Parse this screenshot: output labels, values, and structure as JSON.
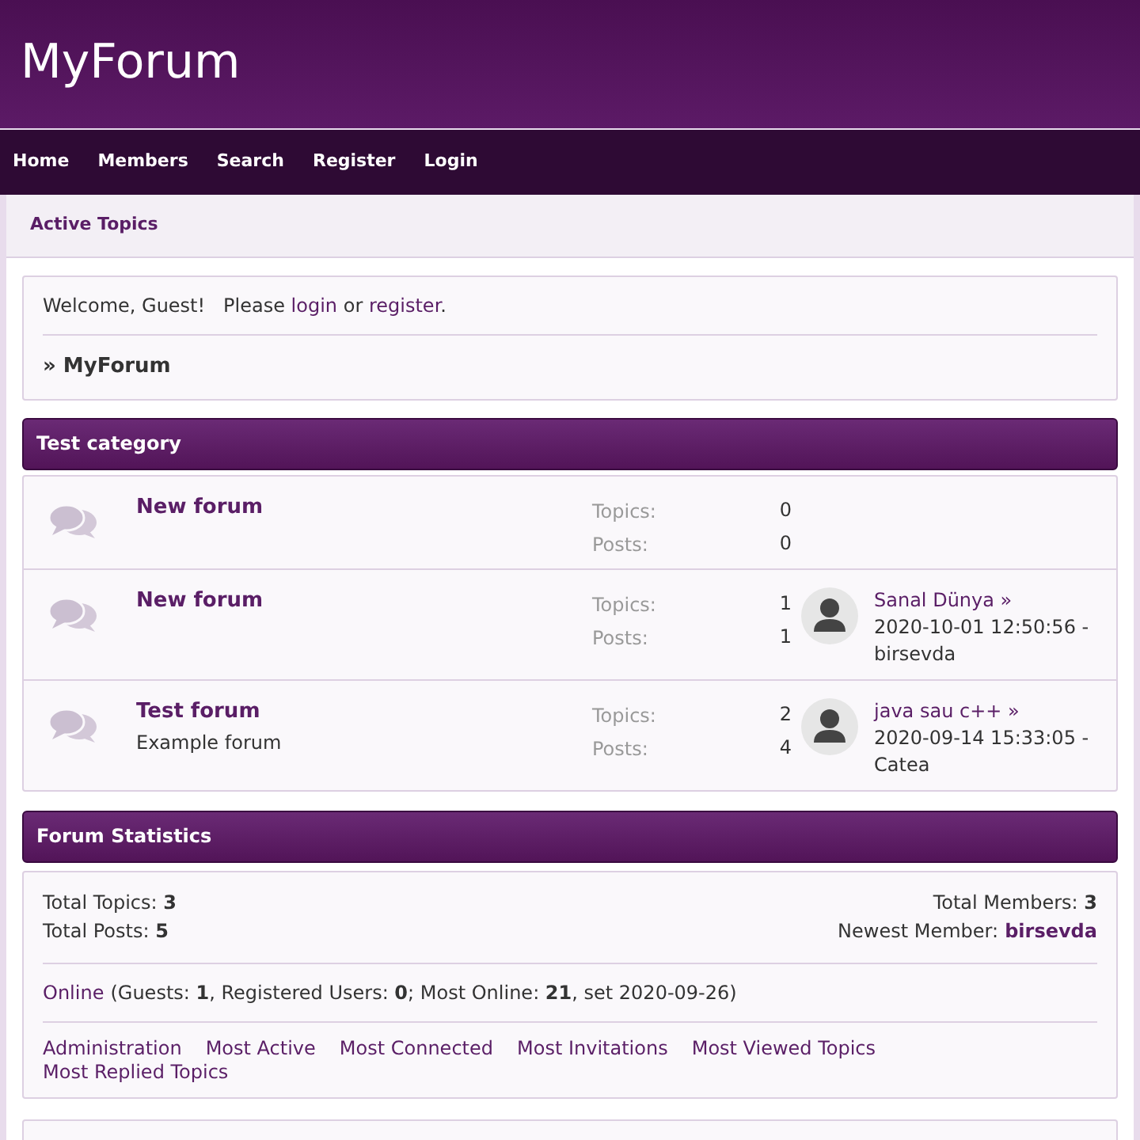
{
  "site_title": "MyForum",
  "nav": [
    "Home",
    "Members",
    "Search",
    "Register",
    "Login"
  ],
  "subnav": "Active Topics",
  "welcome": {
    "text": "Welcome, Guest!   Please",
    "login": "login",
    "or": "or",
    "register": "register",
    "end": "."
  },
  "breadcrumb": "» MyForum",
  "categories": [
    {
      "title": "Test category",
      "forums": [
        {
          "name": "New forum",
          "topics_label": "Topics:",
          "topics": "0",
          "posts_label": "Posts:",
          "posts": "0"
        },
        {
          "name": "New forum",
          "topics_label": "Topics:",
          "topics": "1",
          "posts_label": "Posts:",
          "posts": "1",
          "last_post": {
            "title": "Sanal Dünya »",
            "date": "2020-10-01 12:50:56 -",
            "author": "birsevda"
          }
        },
        {
          "name": "Test forum",
          "description": "Example forum",
          "topics_label": "Topics:",
          "topics": "2",
          "posts_label": "Posts:",
          "posts": "4",
          "last_post": {
            "title": "java sau c++ »",
            "date": "2020-09-14 15:33:05 -",
            "author": "Catea"
          }
        }
      ]
    }
  ],
  "statistics": {
    "title": "Forum Statistics",
    "total_topics": "Total Topics: **3**",
    "total_posts": "Total Posts: **5**",
    "total_members": "Total Members: **3**",
    "newest_member_label": "Newest Member:",
    "newest_member": "birsevda",
    "online_link": "Online",
    "online_text": "(Guests: **1**, Registered Users: **0**; Most Online: **21**, set 2020-09-26)",
    "links": [
      "Administration",
      "Most Active",
      "Most Connected",
      "Most Invitations",
      "Most Viewed Topics",
      "Most Replied Topics"
    ]
  }
}
